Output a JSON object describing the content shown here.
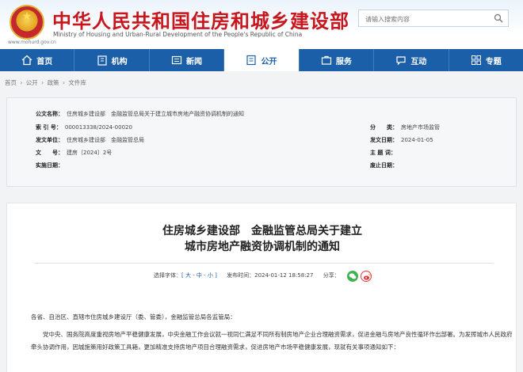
{
  "site": {
    "title": "中华人民共和国住房和城乡建设部",
    "subtitle": "Ministry of Housing and Urban-Rural Development of the People's Republic of China",
    "url": "www.mohurd.gov.cn",
    "search_placeholder": "请输入搜索内容"
  },
  "nav": [
    {
      "label": "首页",
      "icon": "home-icon"
    },
    {
      "label": "机构",
      "icon": "building-icon"
    },
    {
      "label": "新闻",
      "icon": "news-icon"
    },
    {
      "label": "公开",
      "icon": "publish-icon",
      "active": true
    },
    {
      "label": "服务",
      "icon": "service-icon"
    },
    {
      "label": "互动",
      "icon": "chat-icon"
    },
    {
      "label": "专题",
      "icon": "topic-icon"
    }
  ],
  "breadcrumb": [
    "首页",
    "公开",
    "政策",
    "文件库"
  ],
  "breadcrumb_sep": "›",
  "meta": {
    "publisher_label": "公文名称：",
    "publisher_value": "住房城乡建设部　金融监管总局关于建立城市房地产融资协调机制的通知",
    "index_label": "索 引 号：",
    "index_value": "000013338/2024-00020",
    "category_label": "分　　类：",
    "category_value": "房地产市场监管",
    "issuer_label": "发文单位：",
    "issuer_value": "住房城乡建设部　金融监管总局",
    "date_label": "发文日期：",
    "date_value": "2024-01-05",
    "docno_label": "文　　号：",
    "docno_value": "建房〔2024〕2号",
    "topic_label": "主 题 词：",
    "topic_value": "",
    "impl_label": "实施日期：",
    "impl_value": "",
    "expire_label": "废止日期：",
    "expire_value": ""
  },
  "article": {
    "title_line1": "住房城乡建设部　金融监管总局关于建立",
    "title_line2": "城市房地产融资协调机制的通知",
    "font_size_label": "选择字体：",
    "font_size_options": "[ 大 - 中 - 小 ]",
    "publish_time_label": "发布时间：",
    "publish_time": "2024-01-12 18:58:27",
    "share_label": "分享：",
    "para1": "各省、自治区、直辖市住房城乡建设厅（委、管委），金融监管总局各监管局：",
    "para2": "　　党中央、国务院高度重视房地产平稳健康发展，中央金融工作会议就一视同仁满足不同所有制房地产企业合理融资需求，促进金融与房地产良性循环作出部署。为发挥城市人民政府牵头协调作用，因城施策用好政策工具箱，更加精准支持房地产项目合理融资需求，促进房地产市场平稳健康发展，现就有关事项通知如下："
  },
  "colors": {
    "brand_red": "#c8161d",
    "nav_blue": "#1b5fa8"
  }
}
